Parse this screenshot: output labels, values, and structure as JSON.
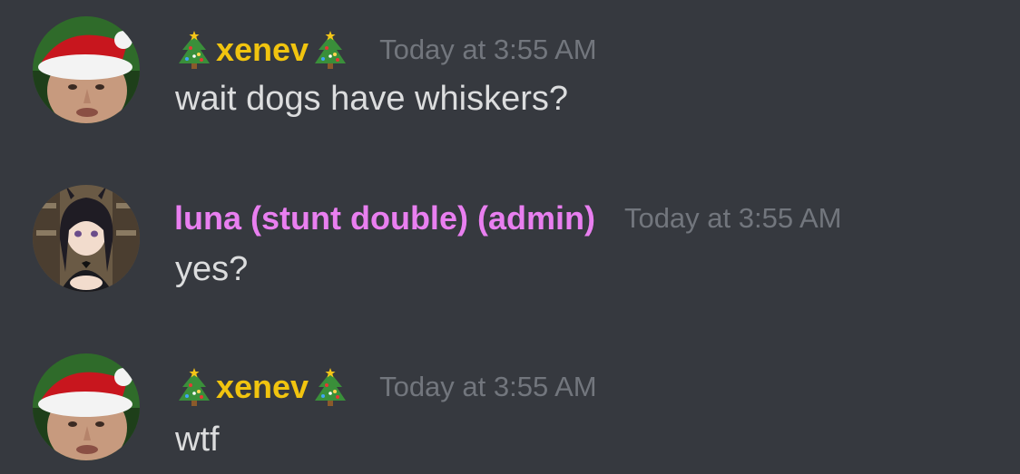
{
  "messages": [
    {
      "author": "xenev",
      "author_prefix_icon": "christmas-tree-icon",
      "author_suffix_icon": "christmas-tree-icon",
      "author_color": "#f1c40f",
      "timestamp": "Today at 3:55 AM",
      "text": "wait dogs have whiskers?",
      "avatar": "santa-hat-avatar"
    },
    {
      "author": "luna (stunt double) (admin)",
      "author_color": "#e97ff0",
      "timestamp": "Today at 3:55 AM",
      "text": "yes?",
      "avatar": "anime-bunny-girl-avatar"
    },
    {
      "author": "xenev",
      "author_prefix_icon": "christmas-tree-icon",
      "author_suffix_icon": "christmas-tree-icon",
      "author_color": "#f1c40f",
      "timestamp": "Today at 3:55 AM",
      "text": "wtf",
      "avatar": "santa-hat-avatar"
    }
  ],
  "colors": {
    "background": "#36393f",
    "message_text": "#dcddde",
    "timestamp": "#72767d"
  }
}
